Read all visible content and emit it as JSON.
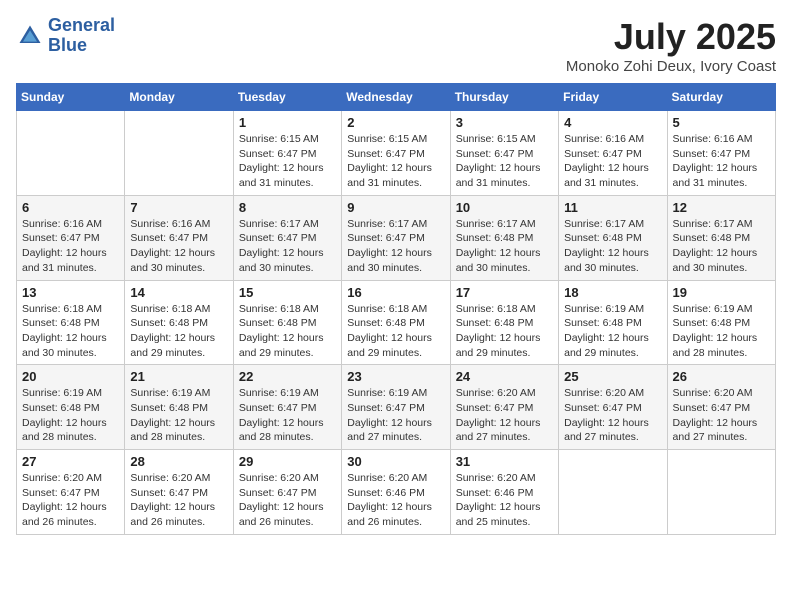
{
  "header": {
    "logo_line1": "General",
    "logo_line2": "Blue",
    "month": "July 2025",
    "location": "Monoko Zohi Deux, Ivory Coast"
  },
  "weekdays": [
    "Sunday",
    "Monday",
    "Tuesday",
    "Wednesday",
    "Thursday",
    "Friday",
    "Saturday"
  ],
  "weeks": [
    [
      {
        "day": "",
        "info": ""
      },
      {
        "day": "",
        "info": ""
      },
      {
        "day": "1",
        "info": "Sunrise: 6:15 AM\nSunset: 6:47 PM\nDaylight: 12 hours and 31 minutes."
      },
      {
        "day": "2",
        "info": "Sunrise: 6:15 AM\nSunset: 6:47 PM\nDaylight: 12 hours and 31 minutes."
      },
      {
        "day": "3",
        "info": "Sunrise: 6:15 AM\nSunset: 6:47 PM\nDaylight: 12 hours and 31 minutes."
      },
      {
        "day": "4",
        "info": "Sunrise: 6:16 AM\nSunset: 6:47 PM\nDaylight: 12 hours and 31 minutes."
      },
      {
        "day": "5",
        "info": "Sunrise: 6:16 AM\nSunset: 6:47 PM\nDaylight: 12 hours and 31 minutes."
      }
    ],
    [
      {
        "day": "6",
        "info": "Sunrise: 6:16 AM\nSunset: 6:47 PM\nDaylight: 12 hours and 31 minutes."
      },
      {
        "day": "7",
        "info": "Sunrise: 6:16 AM\nSunset: 6:47 PM\nDaylight: 12 hours and 30 minutes."
      },
      {
        "day": "8",
        "info": "Sunrise: 6:17 AM\nSunset: 6:47 PM\nDaylight: 12 hours and 30 minutes."
      },
      {
        "day": "9",
        "info": "Sunrise: 6:17 AM\nSunset: 6:47 PM\nDaylight: 12 hours and 30 minutes."
      },
      {
        "day": "10",
        "info": "Sunrise: 6:17 AM\nSunset: 6:48 PM\nDaylight: 12 hours and 30 minutes."
      },
      {
        "day": "11",
        "info": "Sunrise: 6:17 AM\nSunset: 6:48 PM\nDaylight: 12 hours and 30 minutes."
      },
      {
        "day": "12",
        "info": "Sunrise: 6:17 AM\nSunset: 6:48 PM\nDaylight: 12 hours and 30 minutes."
      }
    ],
    [
      {
        "day": "13",
        "info": "Sunrise: 6:18 AM\nSunset: 6:48 PM\nDaylight: 12 hours and 30 minutes."
      },
      {
        "day": "14",
        "info": "Sunrise: 6:18 AM\nSunset: 6:48 PM\nDaylight: 12 hours and 29 minutes."
      },
      {
        "day": "15",
        "info": "Sunrise: 6:18 AM\nSunset: 6:48 PM\nDaylight: 12 hours and 29 minutes."
      },
      {
        "day": "16",
        "info": "Sunrise: 6:18 AM\nSunset: 6:48 PM\nDaylight: 12 hours and 29 minutes."
      },
      {
        "day": "17",
        "info": "Sunrise: 6:18 AM\nSunset: 6:48 PM\nDaylight: 12 hours and 29 minutes."
      },
      {
        "day": "18",
        "info": "Sunrise: 6:19 AM\nSunset: 6:48 PM\nDaylight: 12 hours and 29 minutes."
      },
      {
        "day": "19",
        "info": "Sunrise: 6:19 AM\nSunset: 6:48 PM\nDaylight: 12 hours and 28 minutes."
      }
    ],
    [
      {
        "day": "20",
        "info": "Sunrise: 6:19 AM\nSunset: 6:48 PM\nDaylight: 12 hours and 28 minutes."
      },
      {
        "day": "21",
        "info": "Sunrise: 6:19 AM\nSunset: 6:48 PM\nDaylight: 12 hours and 28 minutes."
      },
      {
        "day": "22",
        "info": "Sunrise: 6:19 AM\nSunset: 6:47 PM\nDaylight: 12 hours and 28 minutes."
      },
      {
        "day": "23",
        "info": "Sunrise: 6:19 AM\nSunset: 6:47 PM\nDaylight: 12 hours and 27 minutes."
      },
      {
        "day": "24",
        "info": "Sunrise: 6:20 AM\nSunset: 6:47 PM\nDaylight: 12 hours and 27 minutes."
      },
      {
        "day": "25",
        "info": "Sunrise: 6:20 AM\nSunset: 6:47 PM\nDaylight: 12 hours and 27 minutes."
      },
      {
        "day": "26",
        "info": "Sunrise: 6:20 AM\nSunset: 6:47 PM\nDaylight: 12 hours and 27 minutes."
      }
    ],
    [
      {
        "day": "27",
        "info": "Sunrise: 6:20 AM\nSunset: 6:47 PM\nDaylight: 12 hours and 26 minutes."
      },
      {
        "day": "28",
        "info": "Sunrise: 6:20 AM\nSunset: 6:47 PM\nDaylight: 12 hours and 26 minutes."
      },
      {
        "day": "29",
        "info": "Sunrise: 6:20 AM\nSunset: 6:47 PM\nDaylight: 12 hours and 26 minutes."
      },
      {
        "day": "30",
        "info": "Sunrise: 6:20 AM\nSunset: 6:46 PM\nDaylight: 12 hours and 26 minutes."
      },
      {
        "day": "31",
        "info": "Sunrise: 6:20 AM\nSunset: 6:46 PM\nDaylight: 12 hours and 25 minutes."
      },
      {
        "day": "",
        "info": ""
      },
      {
        "day": "",
        "info": ""
      }
    ]
  ]
}
